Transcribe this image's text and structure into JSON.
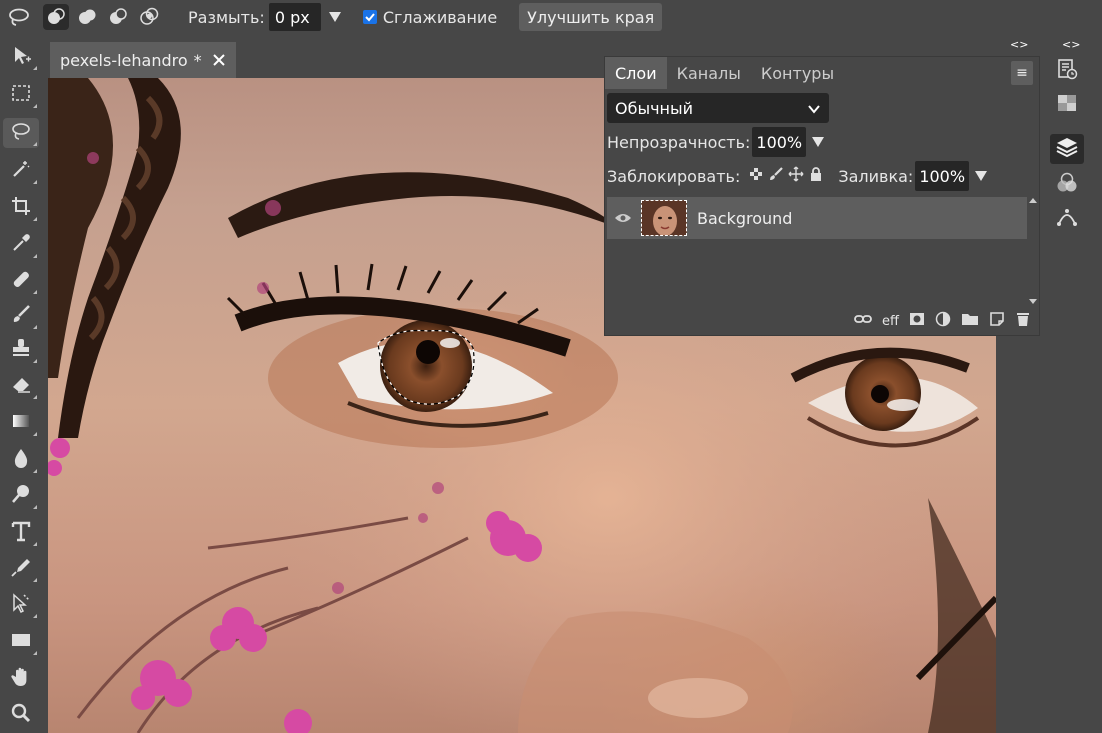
{
  "options": {
    "feather_label": "Размыть:",
    "feather_value": "0 px",
    "antialias_label": "Сглаживание",
    "antialias_checked": true,
    "refine_label": "Улучшить края",
    "modes": [
      "new-selection",
      "add",
      "subtract",
      "intersect"
    ],
    "active_mode": 0
  },
  "tools": [
    "move-icon",
    "marquee-icon",
    "lasso-icon",
    "magic-wand-icon",
    "crop-icon",
    "eyedropper-icon",
    "healing-icon",
    "brush-icon",
    "stamp-icon",
    "eraser-icon",
    "gradient-icon",
    "blur-icon",
    "dodge-icon",
    "type-icon",
    "pen-icon",
    "path-select-icon",
    "shape-icon",
    "hand-icon",
    "zoom-icon"
  ],
  "active_tool": "lasso-icon",
  "document": {
    "tab_title": "pexels-lehandro",
    "modified_marker": "*"
  },
  "layers_panel": {
    "tabs": [
      "Слои",
      "Каналы",
      "Контуры"
    ],
    "active_tab": 0,
    "blend_mode": "Обычный",
    "opacity_label": "Непрозрачность:",
    "opacity_value": "100%",
    "lock_label": "Заблокировать:",
    "fill_label": "Заливка:",
    "fill_value": "100%",
    "layers": [
      {
        "name": "Background",
        "visible": true
      }
    ],
    "bottom_text_eff": "eff"
  },
  "right_column": {
    "collapse_glyph": "<>"
  },
  "colors": {
    "ui_bg": "#474747",
    "panel_active": "#5e5e5e",
    "input_bg": "#262626",
    "checkbox": "#1a73e8"
  }
}
